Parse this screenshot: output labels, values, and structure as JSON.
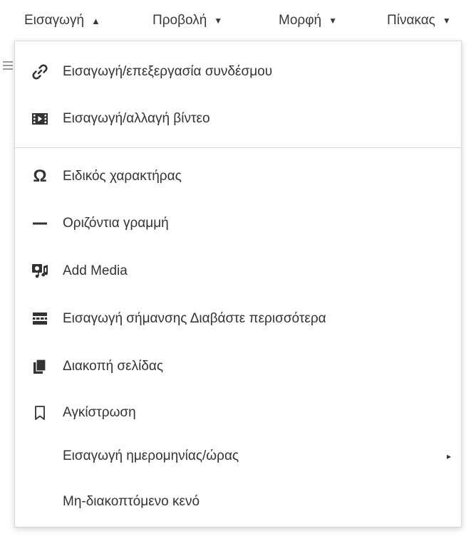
{
  "menubar": {
    "items": [
      {
        "label": "Εισαγωγή",
        "caret": "▲"
      },
      {
        "label": "Προβολή",
        "caret": "▼"
      },
      {
        "label": "Μορφή",
        "caret": "▼"
      },
      {
        "label": "Πίνακας",
        "caret": "▼"
      }
    ]
  },
  "insert_menu": {
    "items": [
      {
        "label": "Εισαγωγή/επεξεργασία συνδέσμου",
        "icon": "link-icon"
      },
      {
        "label": "Εισαγωγή/αλλαγή βίντεο",
        "icon": "video-icon"
      },
      {
        "label": "Ειδικός χαρακτήρας",
        "icon": "omega-icon",
        "glyph": "Ω"
      },
      {
        "label": "Οριζόντια γραμμή",
        "icon": "horizontal-line-icon"
      },
      {
        "label": "Add Media",
        "icon": "add-media-icon"
      },
      {
        "label": "Εισαγωγή σήμανσης Διαβάστε περισσότερα",
        "icon": "read-more-icon"
      },
      {
        "label": "Διακοπή σελίδας",
        "icon": "page-break-icon"
      },
      {
        "label": "Αγκίστρωση",
        "icon": "bookmark-icon"
      },
      {
        "label": "Εισαγωγή ημερομηνίας/ώρας",
        "submenu_arrow": "▸"
      },
      {
        "label": "Μη-διακοπτόμενο κενό"
      }
    ]
  }
}
